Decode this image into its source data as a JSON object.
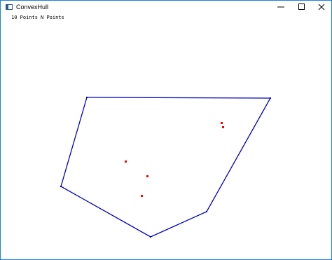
{
  "window": {
    "title": "ConvexHull"
  },
  "menu": {
    "items": [
      {
        "label": "10 Points"
      },
      {
        "label": "N Points"
      }
    ]
  },
  "colors": {
    "hull_line": "#0000cc",
    "point": "#ff0000",
    "window_border": "#1883d7"
  },
  "icons": {
    "app": "app-window-icon",
    "minimize": "minimize-icon",
    "maximize": "maximize-icon",
    "close": "close-icon"
  }
}
